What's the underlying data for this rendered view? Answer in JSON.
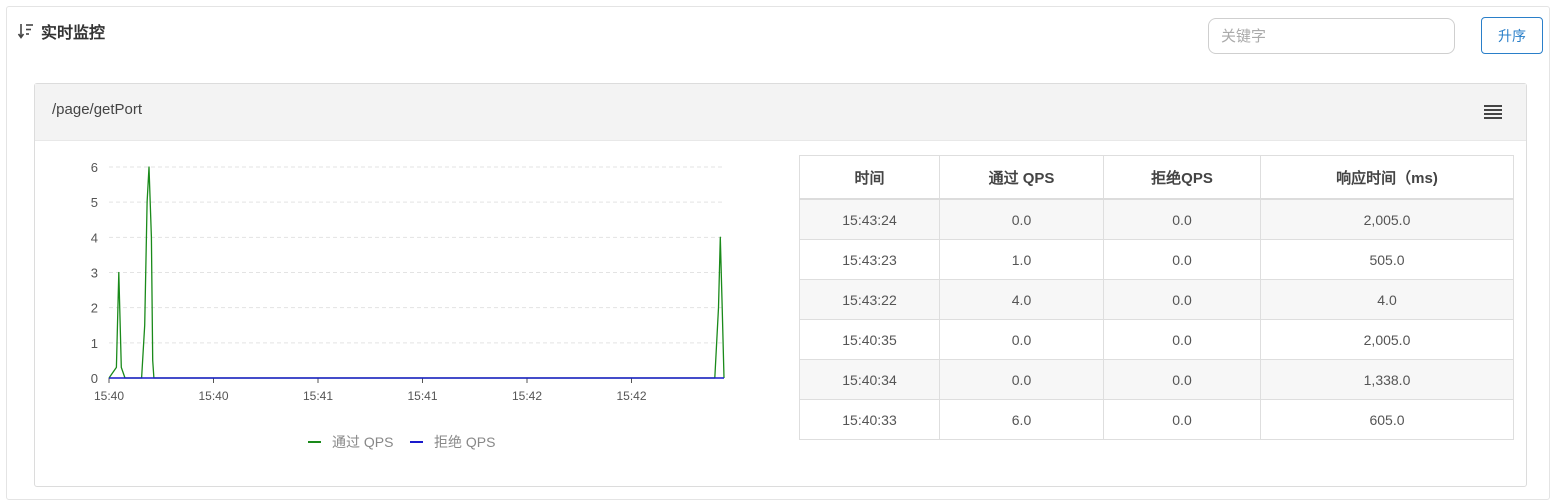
{
  "header": {
    "title": "实时监控",
    "search_placeholder": "关键字",
    "sort_button_label": "升序"
  },
  "panel": {
    "title": "/page/getPort"
  },
  "chart_data": {
    "type": "line",
    "x_ticks": [
      "15:40",
      "15:40",
      "15:41",
      "15:41",
      "15:42",
      "15:42"
    ],
    "y_ticks": [
      0,
      1,
      2,
      3,
      4,
      5,
      6
    ],
    "ylim": [
      0,
      6
    ],
    "grid": true,
    "legend_position": "bottom",
    "series": [
      {
        "name": "通过 QPS",
        "color": "#1a8a1a",
        "points": [
          [
            0.0,
            0
          ],
          [
            0.012,
            0.3
          ],
          [
            0.016,
            3
          ],
          [
            0.02,
            0.3
          ],
          [
            0.026,
            0
          ],
          [
            0.053,
            0
          ],
          [
            0.058,
            1.5
          ],
          [
            0.062,
            5
          ],
          [
            0.065,
            6
          ],
          [
            0.069,
            4
          ],
          [
            0.071,
            0.5
          ],
          [
            0.073,
            0
          ],
          [
            0.985,
            0
          ],
          [
            0.991,
            2
          ],
          [
            0.994,
            4
          ],
          [
            0.997,
            2
          ],
          [
            1.0,
            0
          ]
        ]
      },
      {
        "name": "拒绝 QPS",
        "color": "#1a1acc",
        "points": [
          [
            0.0,
            0
          ],
          [
            1.0,
            0
          ]
        ]
      }
    ]
  },
  "table": {
    "headers": [
      "时间",
      "通过 QPS",
      "拒绝QPS",
      "响应时间（ms)"
    ],
    "rows": [
      [
        "15:43:24",
        "0.0",
        "0.0",
        "2,005.0"
      ],
      [
        "15:43:23",
        "1.0",
        "0.0",
        "505.0"
      ],
      [
        "15:43:22",
        "4.0",
        "0.0",
        "4.0"
      ],
      [
        "15:40:35",
        "0.0",
        "0.0",
        "2,005.0"
      ],
      [
        "15:40:34",
        "0.0",
        "0.0",
        "1,338.0"
      ],
      [
        "15:40:33",
        "6.0",
        "0.0",
        "605.0"
      ]
    ]
  }
}
